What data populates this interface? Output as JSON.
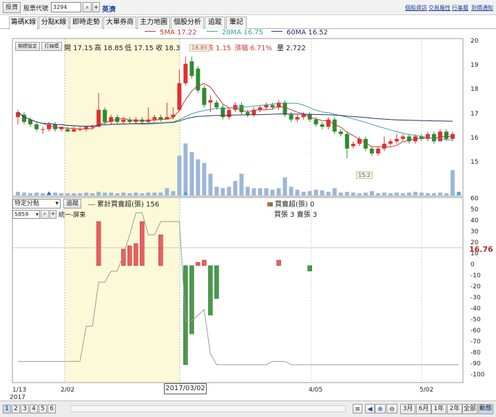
{
  "toolbar": {
    "back": "投資",
    "code_label": "股票代號",
    "code": "3294",
    "name": "英濟",
    "links": [
      "個股資訊",
      "交易屬性",
      "行事曆",
      "到價通知"
    ]
  },
  "tabs": [
    "籌碼K線",
    "分點K線",
    "即時走勢",
    "大單券商",
    "主力地圖",
    "個股分析",
    "追蹤",
    "筆記"
  ],
  "legend": {
    "ma5": "5MA 17.22",
    "ma20": "20MA 16.75",
    "ma60": "60MA 16.52",
    "ma5_color": "#b83a3a",
    "ma20_color": "#3aa0a0",
    "ma60_color": "#2b2b6e"
  },
  "price_info": {
    "btn1": "期標設定",
    "btn2": "打線模",
    "open": "開 17.15",
    "high": "高 18.85",
    "low": "低 17.15",
    "close": "收 18.3",
    "change": "漲跌 1.15",
    "pct": "漲幅 6.71%",
    "volume": "量 2,722"
  },
  "lower_controls": {
    "select": "特定分點",
    "track": "追蹤",
    "title": "累計買賣超(張) 156",
    "broker_code": "5859",
    "broker_name": "統一-屏東",
    "net_label": "買賣超(張) 0",
    "buysell": "買張 3 賣張 3"
  },
  "bottom": {
    "pages": [
      "1",
      "2",
      "3",
      "4",
      "5",
      "6"
    ],
    "ranges": [
      "3月",
      "6月",
      "1年",
      "2年",
      "全部",
      "動態"
    ]
  },
  "chart_data": {
    "type": "candlestick",
    "xaxis_labels": [
      "1/13",
      "2017",
      "2/02",
      "4/05",
      "5/02"
    ],
    "crosshair_date": "2017/03/02",
    "yaxis_top": [
      20,
      19,
      18,
      17,
      16,
      15
    ],
    "yaxis_bottom": [
      60,
      50,
      40,
      30,
      20,
      10,
      0,
      -10,
      -20,
      -30,
      -40,
      -50,
      -60,
      -70,
      -80,
      -90,
      -100
    ],
    "high_marker": "18.85",
    "low_marker": "15.2",
    "right_value": "16.76",
    "ylim_top": [
      14.8,
      20.3
    ],
    "ylim_bottom": [
      -105,
      62
    ],
    "candles": [
      {
        "o": 16.9,
        "c": 17.1,
        "h": 17.2,
        "l": 16.6
      },
      {
        "o": 17.0,
        "c": 16.7,
        "h": 17.1,
        "l": 16.6
      },
      {
        "o": 16.8,
        "c": 16.6,
        "h": 16.9,
        "l": 16.5
      },
      {
        "o": 16.6,
        "c": 16.4,
        "h": 16.7,
        "l": 16.3
      },
      {
        "o": 16.4,
        "c": 16.4,
        "h": 16.5,
        "l": 16.2
      },
      {
        "o": 16.4,
        "c": 16.6,
        "h": 16.7,
        "l": 16.3
      },
      {
        "o": 16.6,
        "c": 16.4,
        "h": 16.7,
        "l": 16.3
      },
      {
        "o": 16.4,
        "c": 16.5,
        "h": 16.5,
        "l": 16.3
      },
      {
        "o": 16.4,
        "c": 16.3,
        "h": 16.5,
        "l": 16.3
      },
      {
        "o": 16.3,
        "c": 16.4,
        "h": 16.5,
        "l": 16.3
      },
      {
        "o": 16.4,
        "c": 16.4,
        "h": 16.5,
        "l": 16.3
      },
      {
        "o": 16.4,
        "c": 16.5,
        "h": 16.5,
        "l": 16.3
      },
      {
        "o": 16.5,
        "c": 16.5,
        "h": 16.6,
        "l": 16.4
      },
      {
        "o": 16.5,
        "c": 17.2,
        "h": 17.9,
        "l": 16.5
      },
      {
        "o": 17.2,
        "c": 16.7,
        "h": 17.3,
        "l": 16.6
      },
      {
        "o": 16.7,
        "c": 16.9,
        "h": 17.0,
        "l": 16.6
      },
      {
        "o": 16.9,
        "c": 16.7,
        "h": 17.0,
        "l": 16.6
      },
      {
        "o": 16.7,
        "c": 16.8,
        "h": 16.9,
        "l": 16.6
      },
      {
        "o": 16.8,
        "c": 16.7,
        "h": 16.9,
        "l": 16.6
      },
      {
        "o": 16.7,
        "c": 16.8,
        "h": 16.9,
        "l": 16.6
      },
      {
        "o": 16.8,
        "c": 16.7,
        "h": 16.9,
        "l": 16.6
      },
      {
        "o": 16.7,
        "c": 16.8,
        "h": 17.3,
        "l": 16.6
      },
      {
        "o": 16.8,
        "c": 16.9,
        "h": 17.0,
        "l": 16.7
      },
      {
        "o": 16.9,
        "c": 16.8,
        "h": 17.0,
        "l": 16.7
      },
      {
        "o": 16.8,
        "c": 16.9,
        "h": 17.5,
        "l": 16.8
      },
      {
        "o": 16.9,
        "c": 17.0,
        "h": 17.3,
        "l": 16.8
      },
      {
        "o": 17.2,
        "c": 18.3,
        "h": 18.85,
        "l": 17.15
      },
      {
        "o": 18.3,
        "c": 19.1,
        "h": 19.4,
        "l": 18.2
      },
      {
        "o": 19.2,
        "c": 18.6,
        "h": 19.4,
        "l": 18.5
      },
      {
        "o": 18.9,
        "c": 18.0,
        "h": 19.0,
        "l": 17.9
      },
      {
        "o": 18.1,
        "c": 17.4,
        "h": 18.2,
        "l": 17.3
      },
      {
        "o": 17.5,
        "c": 17.6,
        "h": 17.8,
        "l": 17.1
      },
      {
        "o": 17.5,
        "c": 17.3,
        "h": 17.6,
        "l": 17.2
      },
      {
        "o": 17.3,
        "c": 16.9,
        "h": 17.4,
        "l": 16.8
      },
      {
        "o": 16.9,
        "c": 17.2,
        "h": 17.3,
        "l": 16.8
      },
      {
        "o": 17.2,
        "c": 17.4,
        "h": 17.5,
        "l": 17.1
      },
      {
        "o": 17.4,
        "c": 17.1,
        "h": 17.5,
        "l": 17.0
      },
      {
        "o": 17.1,
        "c": 17.0,
        "h": 17.2,
        "l": 16.9
      },
      {
        "o": 17.0,
        "c": 17.2,
        "h": 17.3,
        "l": 16.9
      },
      {
        "o": 17.2,
        "c": 17.3,
        "h": 17.4,
        "l": 17.1
      },
      {
        "o": 17.3,
        "c": 17.4,
        "h": 17.5,
        "l": 17.2
      },
      {
        "o": 17.4,
        "c": 17.3,
        "h": 17.5,
        "l": 17.2
      },
      {
        "o": 17.3,
        "c": 17.5,
        "h": 17.6,
        "l": 17.2
      },
      {
        "o": 17.5,
        "c": 17.0,
        "h": 17.6,
        "l": 16.9
      },
      {
        "o": 17.0,
        "c": 16.8,
        "h": 17.1,
        "l": 16.7
      },
      {
        "o": 16.8,
        "c": 16.9,
        "h": 17.0,
        "l": 16.7
      },
      {
        "o": 16.9,
        "c": 17.0,
        "h": 17.1,
        "l": 16.8
      },
      {
        "o": 17.0,
        "c": 16.8,
        "h": 17.1,
        "l": 16.7
      },
      {
        "o": 16.8,
        "c": 16.6,
        "h": 16.9,
        "l": 16.5
      },
      {
        "o": 16.6,
        "c": 16.5,
        "h": 16.7,
        "l": 16.4
      },
      {
        "o": 16.5,
        "c": 16.8,
        "h": 16.9,
        "l": 16.4
      },
      {
        "o": 16.8,
        "c": 16.3,
        "h": 16.9,
        "l": 16.2
      },
      {
        "o": 16.3,
        "c": 16.2,
        "h": 16.4,
        "l": 16.1
      },
      {
        "o": 16.2,
        "c": 15.6,
        "h": 16.3,
        "l": 15.2
      },
      {
        "o": 15.7,
        "c": 15.8,
        "h": 15.9,
        "l": 15.6
      },
      {
        "o": 15.8,
        "c": 16.0,
        "h": 16.1,
        "l": 15.7
      },
      {
        "o": 16.0,
        "c": 15.6,
        "h": 16.1,
        "l": 15.5
      },
      {
        "o": 15.6,
        "c": 15.4,
        "h": 15.7,
        "l": 15.3
      },
      {
        "o": 15.4,
        "c": 15.6,
        "h": 15.7,
        "l": 15.3
      },
      {
        "o": 15.6,
        "c": 15.8,
        "h": 16.1,
        "l": 15.5
      },
      {
        "o": 15.8,
        "c": 15.9,
        "h": 16.0,
        "l": 15.7
      },
      {
        "o": 15.9,
        "c": 16.0,
        "h": 16.2,
        "l": 15.8
      },
      {
        "o": 16.0,
        "c": 16.1,
        "h": 16.2,
        "l": 15.9
      },
      {
        "o": 16.1,
        "c": 15.9,
        "h": 16.2,
        "l": 15.8
      },
      {
        "o": 15.9,
        "c": 16.1,
        "h": 16.2,
        "l": 15.8
      },
      {
        "o": 16.1,
        "c": 16.0,
        "h": 16.2,
        "l": 15.9
      },
      {
        "o": 16.0,
        "c": 16.2,
        "h": 16.3,
        "l": 15.9
      },
      {
        "o": 16.2,
        "c": 15.9,
        "h": 16.3,
        "l": 15.8
      },
      {
        "o": 15.9,
        "c": 16.3,
        "h": 16.4,
        "l": 15.9
      },
      {
        "o": 16.3,
        "c": 16.0,
        "h": 16.4,
        "l": 15.9
      },
      {
        "o": 16.0,
        "c": 16.2,
        "h": 16.3,
        "l": 15.9
      }
    ],
    "volume_rel": [
      0.05,
      0.04,
      0.03,
      0.04,
      0.03,
      0.03,
      0.04,
      0.03,
      0.03,
      0.03,
      0.03,
      0.04,
      0.03,
      0.05,
      0.04,
      0.04,
      0.03,
      0.04,
      0.03,
      0.04,
      0.03,
      0.04,
      0.04,
      0.04,
      0.1,
      0.06,
      0.55,
      0.72,
      0.6,
      0.5,
      0.45,
      0.3,
      0.12,
      0.1,
      0.12,
      0.2,
      0.3,
      0.12,
      0.1,
      0.1,
      0.1,
      0.08,
      0.1,
      0.25,
      0.12,
      0.08,
      0.05,
      0.06,
      0.08,
      0.07,
      0.05,
      0.1,
      0.04,
      0.05,
      0.04,
      0.03,
      0.04,
      0.06,
      0.03,
      0.04,
      0.03,
      0.04,
      0.03,
      0.04,
      0.05,
      0.04,
      0.03,
      0.03,
      0.04,
      0.03,
      0.35,
      0.05
    ],
    "net_bars": [
      0,
      0,
      0,
      0,
      0,
      0,
      0,
      0,
      0,
      0,
      0,
      0,
      0,
      40,
      0,
      0,
      0,
      15,
      18,
      20,
      40,
      0,
      0,
      28,
      0,
      0,
      0,
      -90,
      -62,
      3,
      5,
      -45,
      -30,
      0,
      0,
      0,
      0,
      0,
      0,
      0,
      0,
      0,
      5,
      0,
      0,
      0,
      0,
      -5,
      0,
      0,
      0,
      0,
      0,
      0,
      0,
      0,
      0,
      0,
      0,
      0,
      0,
      0,
      0,
      0,
      0,
      0,
      0,
      0,
      0,
      0,
      0,
      0
    ],
    "cumulative": [
      -87,
      -87,
      -87,
      -87,
      -87,
      -87,
      -87,
      -87,
      -87,
      -87,
      -87,
      -55,
      -55,
      -15,
      -15,
      -5,
      -5,
      10,
      28,
      48,
      48,
      28,
      28,
      40,
      40,
      40,
      40,
      -50,
      -50,
      -45,
      -40,
      -80,
      -90,
      -90,
      -90,
      -90,
      -90,
      -90,
      -90,
      -90,
      -90,
      -87,
      -87,
      -87,
      -90,
      -90,
      -90,
      -90,
      -90,
      -90,
      -90,
      -90,
      -90,
      -90,
      -90,
      -90,
      -90,
      -90,
      -90,
      -90,
      -90,
      -90,
      -90,
      -90,
      -90,
      -90,
      -90,
      -90,
      -90,
      -90,
      -90,
      -90
    ]
  }
}
